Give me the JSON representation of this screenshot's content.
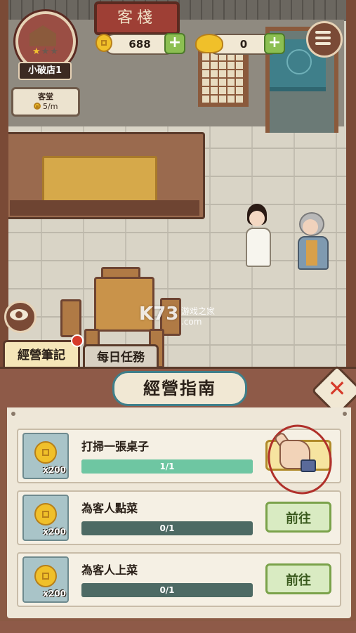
{
  "scene": {
    "sign_text": "客棧"
  },
  "shop": {
    "name": "小破店1",
    "stars_filled": 1,
    "stars_total": 3,
    "income_label": "客堂",
    "income_rate": "5/m"
  },
  "resources": {
    "coins": "688",
    "ingots": "0",
    "add_label": "+"
  },
  "watermark": {
    "main": "K73",
    "sub": "游戏之家",
    "domain": ".com"
  },
  "tabs": [
    {
      "label": "經營筆記",
      "active": true,
      "has_notification": true
    },
    {
      "label": "每日任務",
      "active": false,
      "has_notification": false
    }
  ],
  "panel": {
    "title": "經營指南",
    "tasks": [
      {
        "name": "打掃一張桌子",
        "reward_qty": "x200",
        "progress_text": "1/1",
        "progress": 1.0,
        "action": "claim",
        "button_label": ""
      },
      {
        "name": "為客人點菜",
        "reward_qty": "x200",
        "progress_text": "0/1",
        "progress": 0.0,
        "action": "go",
        "button_label": "前往"
      },
      {
        "name": "為客人上菜",
        "reward_qty": "x200",
        "progress_text": "0/1",
        "progress": 0.0,
        "action": "go",
        "button_label": "前往"
      }
    ]
  },
  "colors": {
    "progress_fill": "#6ec6a2",
    "progress_track": "#4d6a64",
    "notification": "#d63a2a",
    "accent_teal": "#3f7f8a"
  },
  "icons": [
    "shop-icon",
    "star-icon",
    "coin-icon",
    "ingot-icon",
    "menu-icon",
    "eye-icon",
    "close-icon",
    "pointing-hand-icon"
  ]
}
